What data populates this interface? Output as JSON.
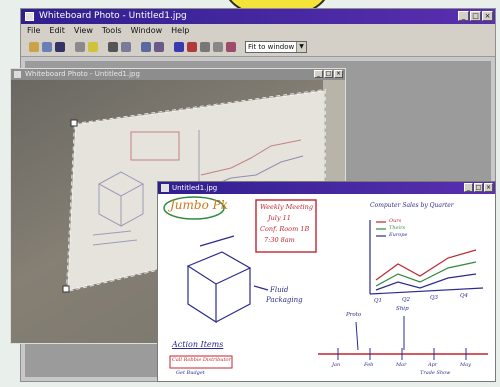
{
  "app": {
    "title": "Whiteboard Photo - Untitled1.jpg",
    "menu": [
      "File",
      "Edit",
      "View",
      "Tools",
      "Window",
      "Help"
    ],
    "zoom_value": "Fit to window",
    "window_controls": [
      "_",
      "□",
      "×"
    ]
  },
  "photo_window": {
    "title": "Whiteboard Photo - Untitled1.jpg"
  },
  "doc_window": {
    "title": "Untitled1.jpg"
  },
  "whiteboard": {
    "project_title": "Jumbo Pk",
    "meeting_note": [
      "Weekly Meeting",
      "July 11",
      "Conf. Room 1B",
      "7:30 8am"
    ],
    "chart_title": "Computer Sales by Quarter",
    "legend": [
      "Ours",
      "Theirs",
      "Europe"
    ],
    "chart_ticks": [
      "Q1",
      "Q2",
      "Q3",
      "Q4"
    ],
    "box_note": [
      "Fluid",
      "Packaging"
    ],
    "action_items_title": "Action Items",
    "action_items": [
      "Call Robbie Distributor",
      "Get Budget"
    ],
    "timeline_labels": [
      "Jan",
      "Feb",
      "Mar",
      "Apr",
      "May"
    ],
    "timeline_marks": [
      "Proto",
      "Ship",
      "Trade Show"
    ]
  },
  "colors": {
    "titlebar": "#3a2a9a",
    "ink_blue": "#2b2b8f",
    "ink_red": "#c0262f",
    "ink_green": "#2f8a3d",
    "highlight_yellow": "#f4e43a"
  },
  "toolbar_icons": [
    "open-icon",
    "save-icon",
    "disk-icon",
    "cut-icon",
    "paint-icon",
    "print-icon",
    "preview-icon",
    "copy-icon",
    "paste-icon",
    "undo-icon",
    "redo-icon",
    "rotate-icon",
    "zoom-icon",
    "pen-icon"
  ]
}
